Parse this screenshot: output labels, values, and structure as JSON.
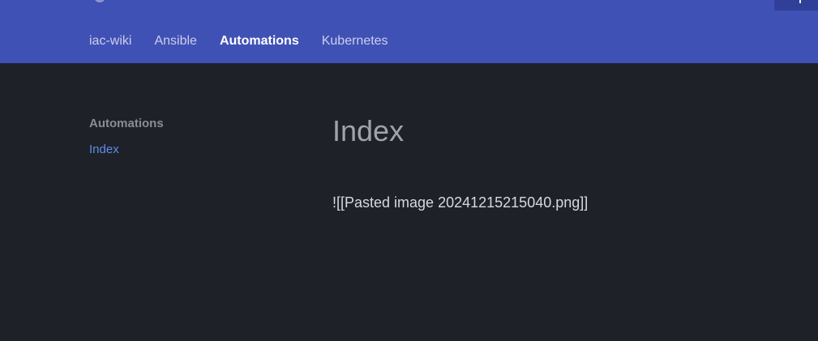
{
  "header": {
    "logo_icon": "site-logo-icon",
    "search_icon": "search-icon",
    "colors": {
      "header_bg": "#4051b5",
      "page_bg": "#1f2129",
      "accent_link": "#5a8ee6"
    }
  },
  "tabs": [
    {
      "label": "iac-wiki",
      "active": false
    },
    {
      "label": "Ansible",
      "active": false
    },
    {
      "label": "Automations",
      "active": true
    },
    {
      "label": "Kubernetes",
      "active": false
    }
  ],
  "sidebar": {
    "heading": "Automations",
    "items": [
      {
        "label": "Index",
        "active": true
      }
    ]
  },
  "main": {
    "title": "Index",
    "body": "![[Pasted image 20241215215040.png]]"
  }
}
